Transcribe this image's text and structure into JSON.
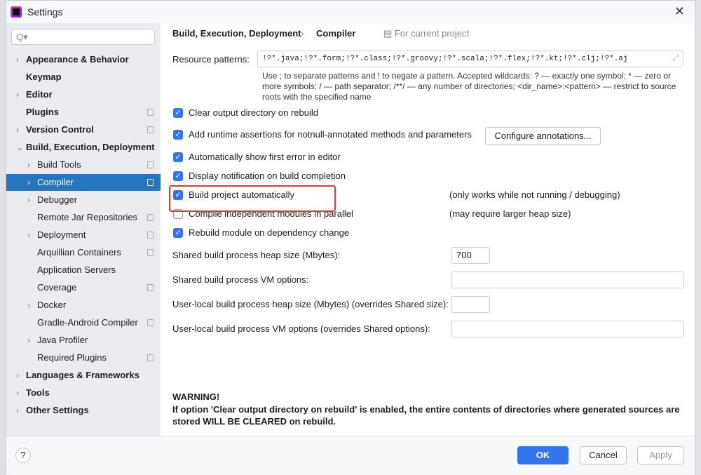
{
  "window": {
    "title": "Settings",
    "close": "✕"
  },
  "search": {
    "placeholder": "Q▾"
  },
  "sidebar": {
    "items": [
      {
        "label": "Appearance & Behavior",
        "level": 0,
        "arrow": "›",
        "bold": true
      },
      {
        "label": "Keymap",
        "level": 0,
        "bold": true
      },
      {
        "label": "Editor",
        "level": 0,
        "arrow": "›",
        "bold": true
      },
      {
        "label": "Plugins",
        "level": 0,
        "bold": true,
        "project": true
      },
      {
        "label": "Version Control",
        "level": 0,
        "arrow": "›",
        "bold": true,
        "project": true
      },
      {
        "label": "Build, Execution, Deployment",
        "level": 0,
        "arrow": "⌄",
        "bold": true
      },
      {
        "label": "Build Tools",
        "level": 1,
        "arrow": "›",
        "project": true
      },
      {
        "label": "Compiler",
        "level": 1,
        "arrow": "›",
        "project": true,
        "selected": true
      },
      {
        "label": "Debugger",
        "level": 1,
        "arrow": "›"
      },
      {
        "label": "Remote Jar Repositories",
        "level": 1,
        "project": true
      },
      {
        "label": "Deployment",
        "level": 1,
        "arrow": "›",
        "project": true
      },
      {
        "label": "Arquillian Containers",
        "level": 1,
        "project": true
      },
      {
        "label": "Application Servers",
        "level": 1
      },
      {
        "label": "Coverage",
        "level": 1,
        "project": true
      },
      {
        "label": "Docker",
        "level": 1,
        "arrow": "›"
      },
      {
        "label": "Gradle-Android Compiler",
        "level": 1,
        "project": true
      },
      {
        "label": "Java Profiler",
        "level": 1,
        "arrow": "›"
      },
      {
        "label": "Required Plugins",
        "level": 1,
        "project": true
      },
      {
        "label": "Languages & Frameworks",
        "level": 0,
        "arrow": "›",
        "bold": true
      },
      {
        "label": "Tools",
        "level": 0,
        "arrow": "›",
        "bold": true
      },
      {
        "label": "Other Settings",
        "level": 0,
        "arrow": "›",
        "bold": true
      }
    ]
  },
  "breadcrumb": {
    "parent": "Build, Execution, Deployment",
    "sep": "›",
    "current": "Compiler",
    "scope": "For current project"
  },
  "resource": {
    "label": "Resource patterns:",
    "value": "!?*.java;!?*.form;!?*.class;!?*.groovy;!?*.scala;!?*.flex;!?*.kt;!?*.clj;!?*.aj",
    "help": "Use ; to separate patterns and ! to negate a pattern. Accepted wildcards: ? — exactly one symbol; * — zero or more symbols; / — path separator; /**/ — any number of directories; <dir_name>:<pattern> — restrict to source roots with the specified name"
  },
  "options": [
    {
      "label": "Clear output directory on rebuild",
      "checked": true
    },
    {
      "label": "Add runtime assertions for notnull-annotated methods and parameters",
      "checked": true
    },
    {
      "label": "Automatically show first error in editor",
      "checked": true
    },
    {
      "label": "Display notification on build completion",
      "checked": true
    },
    {
      "label": "Build project automatically",
      "checked": true,
      "note": "(only works while not running / debugging)"
    },
    {
      "label": "Compile independent modules in parallel",
      "checked": false,
      "note": "(may require larger heap size)"
    },
    {
      "label": "Rebuild module on dependency change",
      "checked": true
    }
  ],
  "configure_button": "Configure annotations...",
  "fields": [
    {
      "label": "Shared build process heap size (Mbytes):",
      "value": "700"
    },
    {
      "label": "Shared build process VM options:",
      "value": ""
    },
    {
      "label": "User-local build process heap size (Mbytes) (overrides Shared size):",
      "value": ""
    },
    {
      "label": "User-local build process VM options (overrides Shared options):",
      "value": ""
    }
  ],
  "warning": {
    "title": "WARNING!",
    "text": "If option 'Clear output directory on rebuild' is enabled, the entire contents of directories where generated sources are stored WILL BE CLEARED on rebuild."
  },
  "footer": {
    "help": "?",
    "ok": "OK",
    "cancel": "Cancel",
    "apply": "Apply"
  },
  "colors": {
    "accent": "#2675bf",
    "highlight": "#e53935"
  }
}
